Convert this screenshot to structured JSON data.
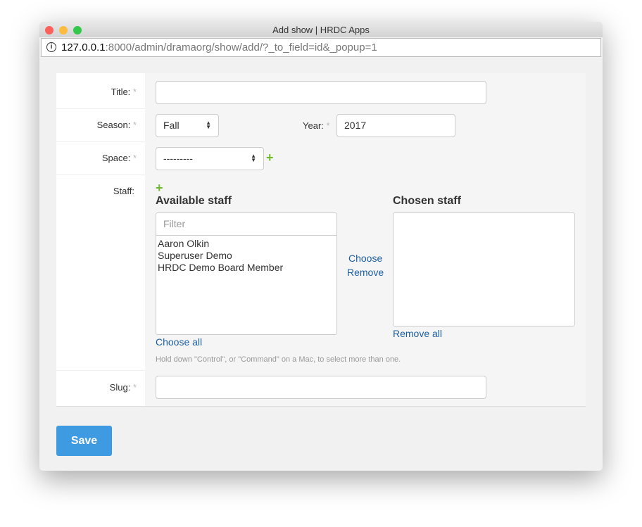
{
  "window": {
    "title": "Add show | HRDC Apps",
    "url_host": "127.0.0.1",
    "url_rest": ":8000/admin/dramaorg/show/add/?_to_field=id&_popup=1"
  },
  "form": {
    "title_label": "Title:",
    "season_label": "Season:",
    "season_value": "Fall",
    "year_label": "Year:",
    "year_value": "2017",
    "space_label": "Space:",
    "space_value": "---------",
    "staff_label": "Staff:",
    "slug_label": "Slug:",
    "required_mark": "*",
    "available_heading": "Available staff",
    "chosen_heading": "Chosen staff",
    "filter_placeholder": "Filter",
    "available_staff": [
      "Aaron Olkin",
      "Superuser Demo",
      "HRDC Demo Board Member"
    ],
    "choose": "Choose",
    "remove": "Remove",
    "choose_all": "Choose all",
    "remove_all": "Remove all",
    "help": "Hold down \"Control\", or \"Command\" on a Mac, to select more than one.",
    "save": "Save"
  },
  "colors": {
    "accent": "#3f9be1",
    "link": "#1e5fa0",
    "add": "#6fba2c"
  }
}
